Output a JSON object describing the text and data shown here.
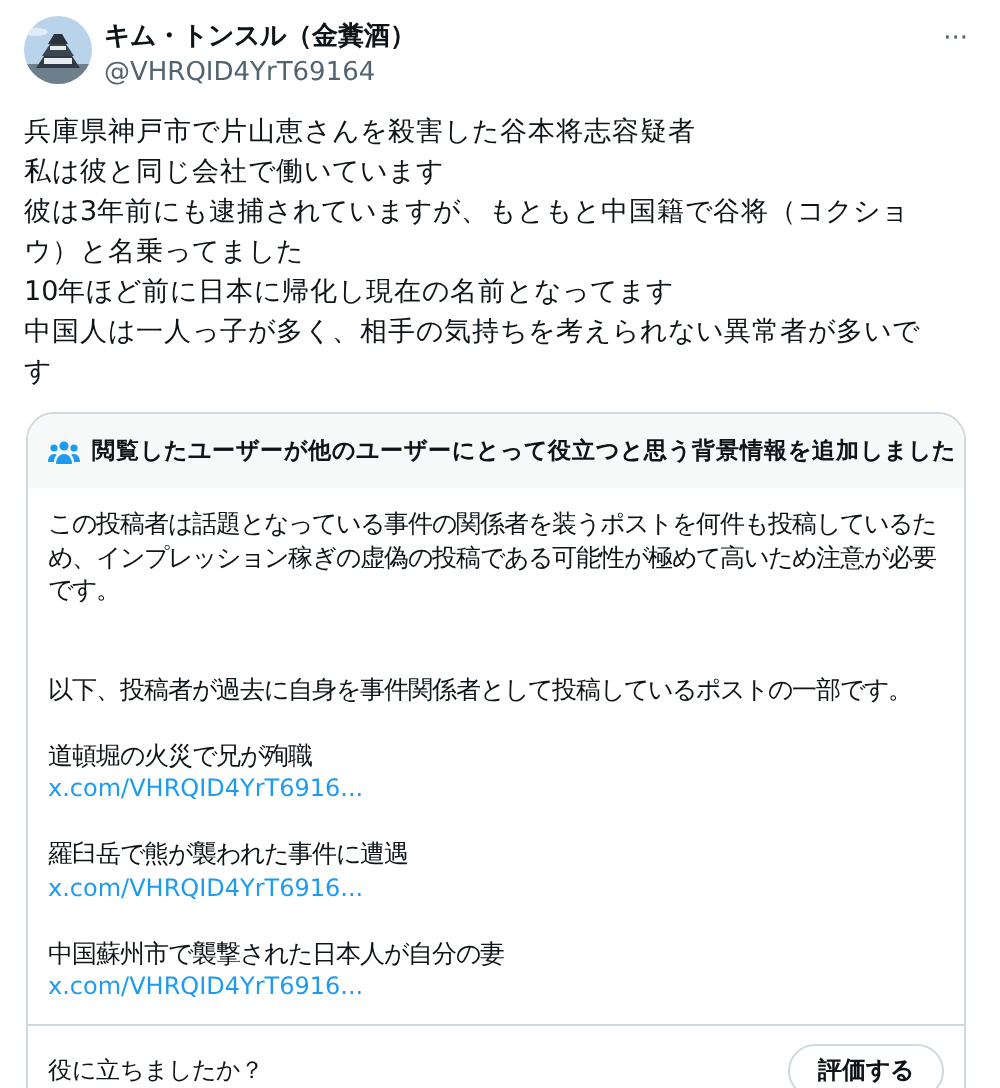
{
  "author": {
    "name": "キム・トンスル（金糞酒）",
    "handle": "@VHRQID4YrT69164"
  },
  "more": "···",
  "body": [
    "兵庫県神戸市で片山恵さんを殺害した谷本将志容疑者",
    "私は彼と同じ会社で働いています",
    "彼は3年前にも逮捕されていますが、もともと中国籍で谷将（コクショウ）と名乗ってました",
    "10年ほど前に日本に帰化し現在の名前となってます",
    "中国人は一人っ子が多く、相手の気持ちを考えられない異常者が多いです"
  ],
  "note": {
    "title": "閲覧したユーザーが他のユーザーにとって役立つと思う背景情報を追加しました",
    "paragraphs": [
      "この投稿者は話題となっている事件の関係者を装うポストを何件も投稿しているため、インプレッション稼ぎの虚偽の投稿である可能性が極めて高いため注意が必要です。",
      "以下、投稿者が過去に自身を事件関係者として投稿しているポストの一部です。"
    ],
    "items": [
      {
        "text": "道頓堀の火災で兄が殉職",
        "link": "x.com/VHRQID4YrT6916..."
      },
      {
        "text": "羅臼岳で熊が襲われた事件に遭遇",
        "link": "x.com/VHRQID4YrT6916..."
      },
      {
        "text": "中国蘇州市で襲撃された日本人が自分の妻",
        "link": "x.com/VHRQID4YrT6916..."
      }
    ],
    "question": "役に立ちましたか？",
    "rate_button": "評価する"
  }
}
